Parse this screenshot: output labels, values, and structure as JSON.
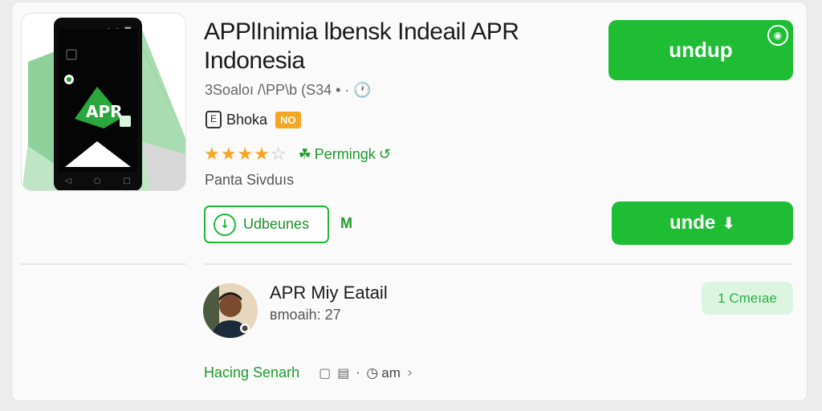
{
  "app": {
    "title_line1": "APPlInimia lbensk Indeail APR",
    "title_line2": "Indonesia",
    "meta": "3Soaloı /\\PP\\b (S34 • · 🕐",
    "developer": "Bhoka",
    "badge": "NO",
    "rating_stars": "★★★★",
    "rating_empty_star": "☆",
    "permission_label": "Permingk",
    "subtitle": "Panta Sivduıs"
  },
  "buttons": {
    "top_label": "undup",
    "outline_label": "Udbeunes",
    "side_label": "M",
    "bottom_label": "unde",
    "bottom_arrow": "⬇"
  },
  "author": {
    "name": "APR Miy Eatail",
    "meta": "вmoaih:  27",
    "chip": "1 Cmeıae"
  },
  "footer": {
    "link": "Hacing Senarh",
    "time": "am",
    "chevron": "›"
  },
  "icons": {
    "pin": "◉",
    "download": "↓",
    "perm_left": "☘",
    "perm_right": "↺",
    "dev": "E",
    "square": "▢",
    "bag": "▤",
    "clock": "◷",
    "phone_dots": "• • ■",
    "nav_back": "◁",
    "nav_home": "○",
    "nav_recent": "□",
    "logo_text": "APR"
  },
  "colors": {
    "accent": "#1ebd34",
    "accent_dark": "#1d9c2c",
    "star": "#f6a623",
    "chip_bg": "#dcf5e0"
  }
}
